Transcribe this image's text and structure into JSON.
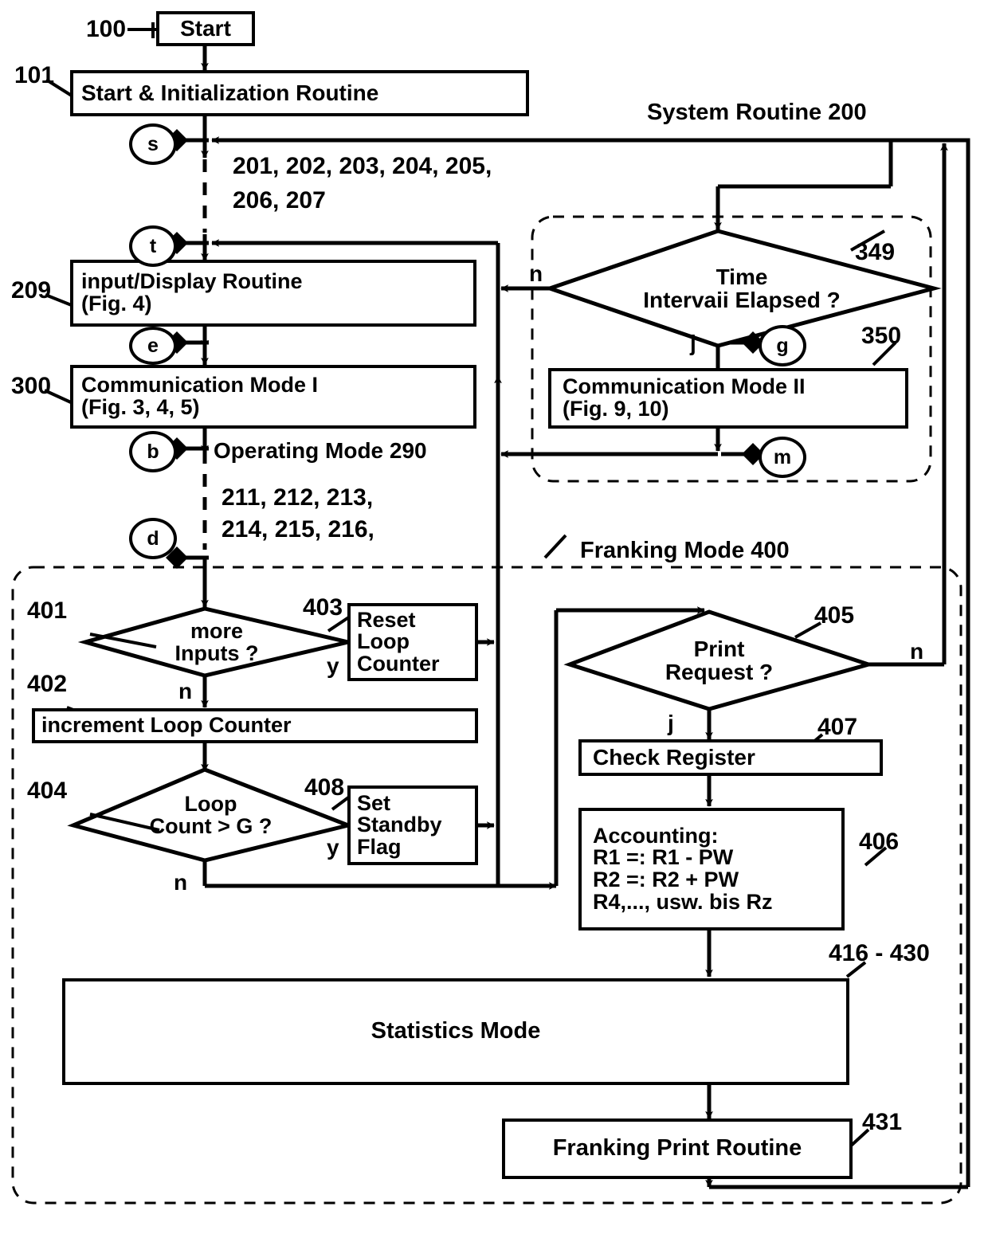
{
  "diagram": {
    "title_system": "System Routine 200",
    "title_franking": "Franking Mode 400",
    "operating_mode": "Operating Mode 290"
  },
  "nodes": {
    "start": "Start",
    "init": "Start   &   Initialization Routine",
    "input_display_l1": "input/Display Routine",
    "input_display_l2": "(Fig. 4)",
    "comm1_l1": "Communication Mode  I",
    "comm1_l2": "(Fig. 3, 4, 5)",
    "comm2_l1": "Communication Mode II",
    "comm2_l2": "(Fig. 9, 10)",
    "time_interval_l1": "Time",
    "time_interval_l2": "Intervaii Elapsed ?",
    "more_inputs_l1": "more",
    "more_inputs_l2": "Inputs ?",
    "reset_loop_l1": "Reset",
    "reset_loop_l2": "Loop",
    "reset_loop_l3": "Counter",
    "increment_loop": "increment Loop Counter",
    "loop_count_l1": "Loop",
    "loop_count_l2": "Count > G ?",
    "set_standby_l1": "Set",
    "set_standby_l2": "Standby",
    "set_standby_l3": "Flag",
    "print_request_l1": "Print",
    "print_request_l2": "Request ?",
    "check_register": "Check Register",
    "accounting_l1": "Accounting:",
    "accounting_l2": "R1 =:  R1 -  PW",
    "accounting_l3": "R2 =:  R2 + PW",
    "accounting_l4": "R4,..., usw. bis Rz",
    "statistics": "Statistics Mode",
    "franking_print": "Franking Print Routine"
  },
  "refs": {
    "r100": "100",
    "r101": "101",
    "r209": "209",
    "r300": "300",
    "r349": "349",
    "r350": "350",
    "r401": "401",
    "r402": "402",
    "r403": "403",
    "r404": "404",
    "r405": "405",
    "r406": "406",
    "r407": "407",
    "r408": "408",
    "r416_430": "416 - 430",
    "r431": "431",
    "steps_2xx_l1": "201, 202, 203, 204, 205,",
    "steps_2xx_l2": "206, 207",
    "steps_21x_l1": "211, 212, 213,",
    "steps_21x_l2": "214, 215, 216,"
  },
  "connectors": {
    "s": "s",
    "t": "t",
    "e": "e",
    "b": "b",
    "d": "d",
    "g": "g",
    "m": "m"
  },
  "branch_labels": {
    "time_n": "n",
    "time_j": "j",
    "more_inputs_y": "y",
    "more_inputs_n": "n",
    "loop_count_y": "y",
    "loop_count_n": "n",
    "print_j": "j",
    "print_n": "n"
  },
  "colors": {
    "ink": "#000000",
    "paper": "#ffffff"
  }
}
